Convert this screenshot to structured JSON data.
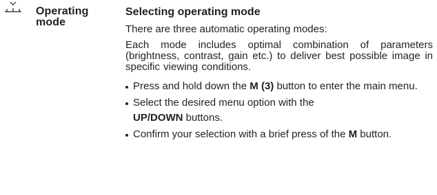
{
  "icon": "mode-selector-icon",
  "section_label": "Operating mode",
  "title": "Selecting operating mode",
  "intro": "There are three automatic operating modes:",
  "description": "Each mode includes optimal combination of parameters (brightness, contrast, gain etc.) to deliver best possible image in specific viewing conditions.",
  "steps": [
    {
      "pre": "Press and hold down the ",
      "bold": "M (3)",
      "post": " button to enter the main menu."
    },
    {
      "pre": "Select the desired menu option with the",
      "bold": "UP/DOWN",
      "post": " buttons."
    },
    {
      "pre": "Confirm your selection with a brief press of the ",
      "bold": "M",
      "post": " button."
    }
  ]
}
